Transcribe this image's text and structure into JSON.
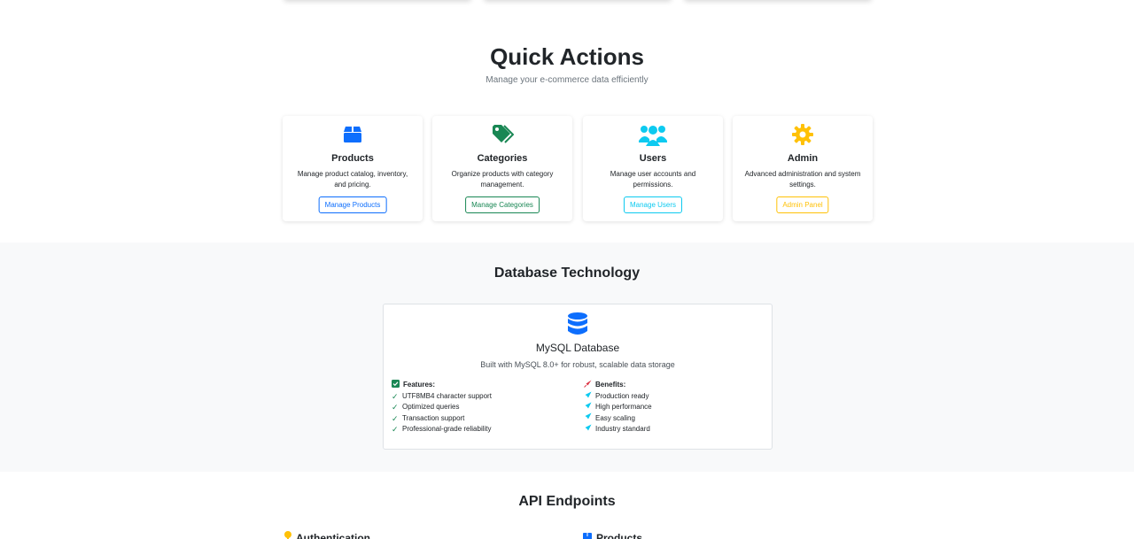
{
  "quick_actions": {
    "title": "Quick Actions",
    "subtitle": "Manage your e-commerce data efficiently",
    "cards": [
      {
        "icon": "box-icon",
        "title": "Products",
        "description": "Manage product catalog, inventory, and pricing.",
        "button": "Manage Products",
        "color": "#0d6efd"
      },
      {
        "icon": "tags-icon",
        "title": "Categories",
        "description": "Organize products with category management.",
        "button": "Manage Categories",
        "color": "#198754"
      },
      {
        "icon": "users-icon",
        "title": "Users",
        "description": "Manage user accounts and permissions.",
        "button": "Manage Users",
        "color": "#0dcaf0"
      },
      {
        "icon": "gear-icon",
        "title": "Admin",
        "description": "Advanced administration and system settings.",
        "button": "Admin Panel",
        "color": "#ffc107"
      }
    ]
  },
  "database": {
    "section_title": "Database Technology",
    "card_title": "MySQL Database",
    "card_description": "Built with MySQL 8.0+ for robust, scalable data storage",
    "features": {
      "heading": "Features:",
      "items": [
        "UTF8MB4 character support",
        "Optimized queries",
        "Transaction support",
        "Professional-grade reliability"
      ]
    },
    "benefits": {
      "heading": "Benefits:",
      "items": [
        "Production ready",
        "High performance",
        "Easy scaling",
        "Industry standard"
      ]
    },
    "accent_color": "#0d6efd"
  },
  "api": {
    "title": "API Endpoints",
    "groups": [
      "Authentication",
      "Products"
    ]
  }
}
